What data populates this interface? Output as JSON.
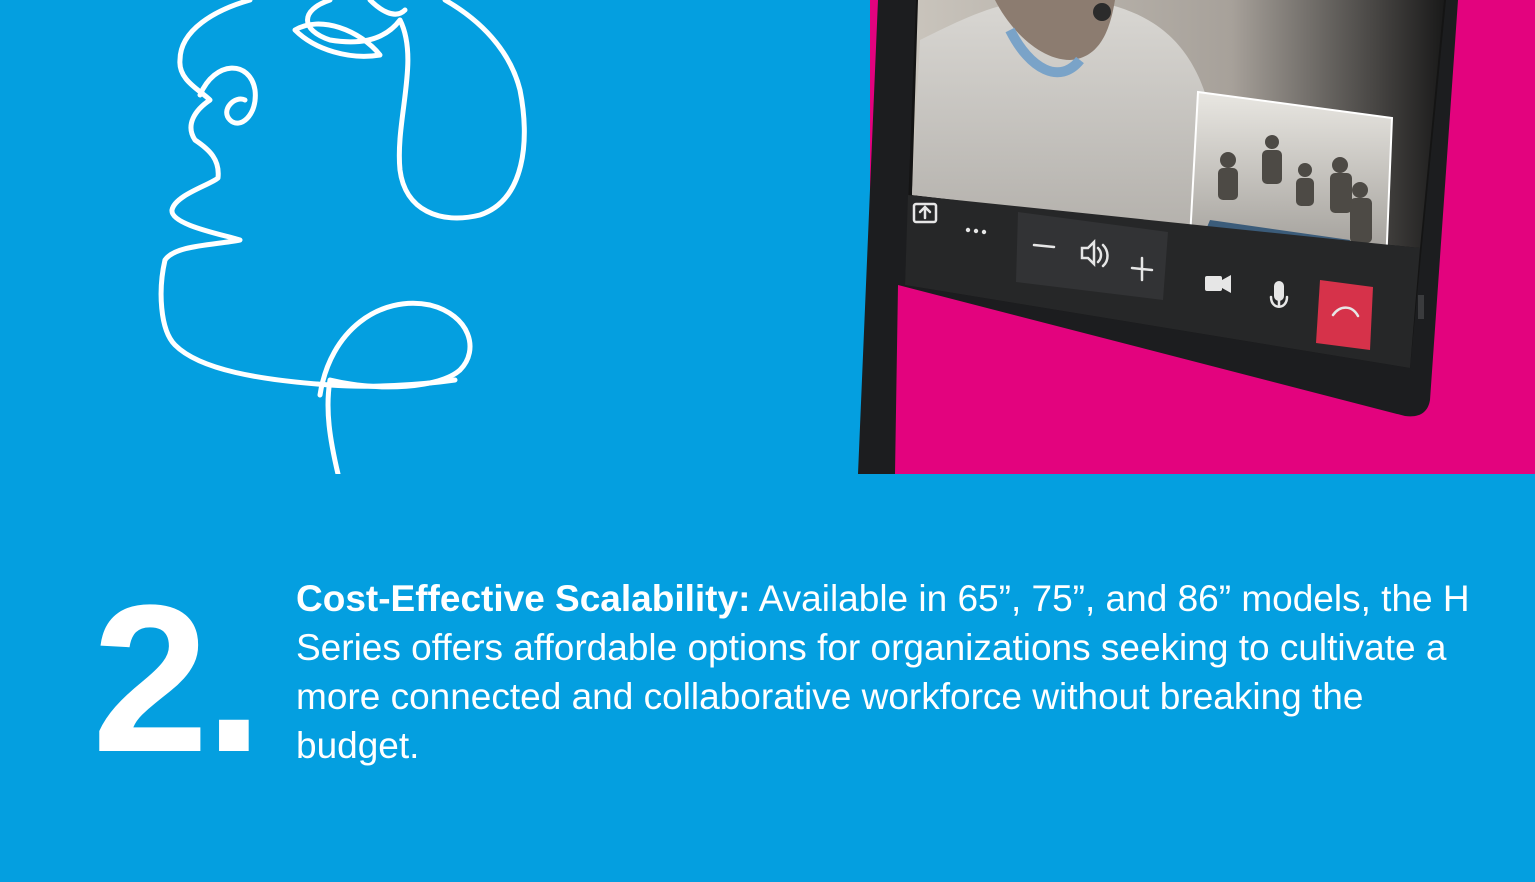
{
  "colors": {
    "blue_background": "#049fe0",
    "magenta_background": "#e3037e",
    "end_call_red": "#d6324a",
    "text": "#ffffff"
  },
  "illustration": {
    "icon": "face-line-art-icon"
  },
  "video_call": {
    "controls": {
      "share_icon": "share-screen-icon",
      "more_label": "...",
      "volume_down_label": "−",
      "volume_icon": "speaker-icon",
      "volume_up_label": "+",
      "camera_icon": "camera-icon",
      "mic_icon": "microphone-icon",
      "end_call_icon": "hang-up-icon"
    }
  },
  "feature": {
    "number": "2.",
    "title": "Cost-Effective Scalability:",
    "body": " Available in 65”, 75”, and 86” models, the H Series offers affordable options for organizations seeking to cultivate a more connected and collaborative workforce without breaking the budget."
  }
}
